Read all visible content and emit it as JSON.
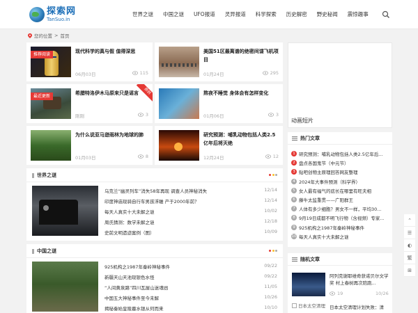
{
  "logo": {
    "name": "探索网",
    "sub": "TanSuo.in"
  },
  "nav": [
    "世界之谜",
    "中国之谜",
    "UFO报道",
    "灵异报道",
    "科学探索",
    "历史解密",
    "野史秘闻",
    "震惊趣事"
  ],
  "breadcrumb": {
    "label": "您的位置",
    "home": "首页"
  },
  "featured": [
    {
      "title": "现代科学的真与假 值得深思",
      "date": "06月03日",
      "views": "115",
      "tag": "推荐阅读"
    },
    {
      "title": "美国51区最离谱的绝密间谍飞机项目",
      "date": "01月24日",
      "views": "295"
    },
    {
      "title": "希腊特洛伊木马原来只是谣言",
      "date": "刚刚",
      "views": "3",
      "tag": "最近更新",
      "ribbon": "原创"
    },
    {
      "title": "熬夜不睡觉 身体会有怎样变化",
      "date": "01月06日",
      "views": "3"
    },
    {
      "title": "为什么说亚马逊雨林为地球的肺",
      "date": "01月03日",
      "views": "8"
    },
    {
      "title": "研究预测：哺乳动物包括人类2.5亿年后将灭绝",
      "date": "12月24日",
      "views": "12"
    }
  ],
  "ad": {
    "label": "动画短片"
  },
  "section_world": {
    "title": "世界之谜",
    "items": [
      {
        "title": "乌克兰“幽灵列车”消失58年再现 调查人员神秘消失",
        "date": "12/14"
      },
      {
        "title": "印度神庙现骑自行车男孩浮雕 产于2000年前？",
        "date": "12/14"
      },
      {
        "title": "每天人真实十大未解之谜",
        "date": "10/02"
      },
      {
        "title": "周氏猜测：数学未解之谜",
        "date": "12/18"
      },
      {
        "title": "史前文明遗迹案例（图）",
        "date": "10/09"
      }
    ]
  },
  "section_china": {
    "title": "中国之谜",
    "items": [
      {
        "title": "925机构之1987年秦岭神秘事件",
        "date": "09/22"
      },
      {
        "title": "新疆天山天池现银色水怪",
        "date": "09/22"
      },
      {
        "title": "“人间黄泉路”四川瓦屋山迷魂凼",
        "date": "11/05"
      },
      {
        "title": "中国五大神秘事件至今未解",
        "date": "10/26"
      },
      {
        "title": "揭秘秦始皇陵墓水银从何而来",
        "date": "10/10"
      }
    ]
  },
  "hot": {
    "title": "热门文章",
    "items": [
      "研究预测：哺乳动物包括人类2.5亿年后...",
      "盘点各国鬼节（中元节）",
      "贴吧创物主原理回答网友整理",
      "2024年大事件预测（科学界）",
      "女人最有福气的痣长在哪里有旺夫相",
      "藤牛太监重贯——广阳群王",
      "人体有多少细胞？男女不一样，平均30...",
      "9月19日成都不明飞行物（含视频）专家...",
      "925机构之1987年秦岭神秘事件",
      "每天人真实十大未解之谜"
    ],
    "colors": [
      "#e53935",
      "#e53935",
      "#e53935",
      "#aaaaaa",
      "#aaaaaa",
      "#aaaaaa",
      "#aaaaaa",
      "#aaaaaa",
      "#aaaaaa",
      "#aaaaaa"
    ]
  },
  "random": {
    "title": "随机文章",
    "items": [
      {
        "title": "阿列克谢耶维奇获诺贝尔文学奖 村上春树再次陪跑...",
        "views": "19",
        "date": "10/26"
      },
      {
        "title": "日本太空清理计划失败：清",
        "img_alt": "日本太空清理"
      }
    ]
  },
  "tools": [
    "⌃",
    "☰",
    "◐",
    "繁",
    "⊞"
  ],
  "colors": {
    "accent": "#e53935",
    "link": "#1c6fb8"
  }
}
